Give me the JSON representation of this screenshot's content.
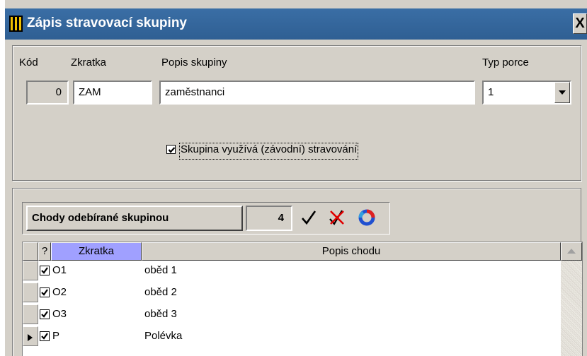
{
  "window": {
    "title": "Zápis stravovací skupiny",
    "close_label": "X"
  },
  "header": {
    "kod_label": "Kód",
    "zkratka_label": "Zkratka",
    "popis_label": "Popis skupiny",
    "typ_label": "Typ porce",
    "kod_value": "0",
    "zkratka_value": "ZAM",
    "popis_value": "zaměstnanci",
    "typ_value": "1",
    "checkbox_label": "Skupina využívá (závodní) stravování",
    "checkbox_checked": true
  },
  "courses": {
    "title": "Chody odebírané skupinou",
    "count": "4",
    "columns": {
      "check": "?",
      "code": "Zkratka",
      "desc": "Popis chodu"
    },
    "rows": [
      {
        "checked": true,
        "code": "O1",
        "desc": "oběd 1"
      },
      {
        "checked": true,
        "code": "O2",
        "desc": "oběd 2"
      },
      {
        "checked": true,
        "code": "O3",
        "desc": "oběd 3"
      },
      {
        "checked": true,
        "code": "P",
        "desc": "Polévka"
      }
    ],
    "current_row": 3
  },
  "icons": {
    "app": "app-icon",
    "check_all": "checkmark-icon",
    "uncheck_all": "red-cross-icon",
    "refresh": "refresh-icon"
  },
  "colors": {
    "titlebar": "#3a6ea5",
    "active_header": "#a0a0ff",
    "face": "#d4d0c8"
  }
}
